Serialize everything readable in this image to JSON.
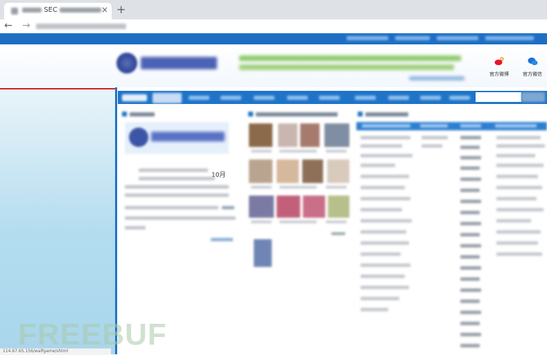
{
  "browser": {
    "tab_title": "SEC",
    "tab_close": "×",
    "new_tab": "+",
    "back": "←",
    "forward": "→"
  },
  "header": {
    "weibo_label": "官方微博",
    "weixin_label": "官方微信",
    "weibo_icon": "weibo-icon",
    "weixin_icon": "wechat-icon"
  },
  "content": {
    "date_text": "10月"
  },
  "watermark": "FREEBUF",
  "status_url": "114.67.65.156/walfgame/shtml",
  "colors": {
    "nav_blue": "#1f74c8",
    "alert_red": "#d42020",
    "slogan_green": "#8dca6b"
  }
}
